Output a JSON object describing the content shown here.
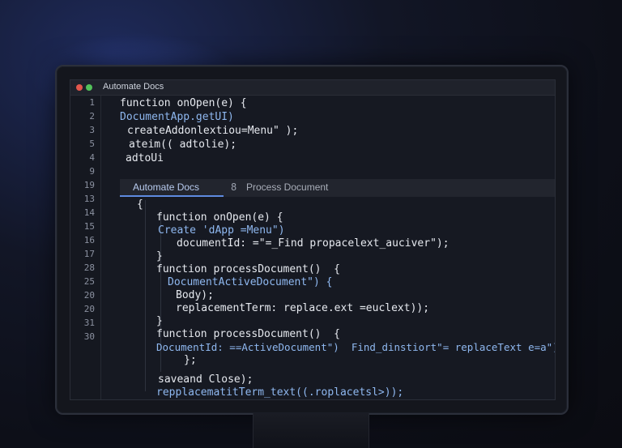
{
  "window": {
    "title": "Automate Docs"
  },
  "tabs": [
    {
      "label": "Automate Docs",
      "active": true
    },
    {
      "label": "Process Document",
      "active": false,
      "icon_glyph": "8"
    }
  ],
  "line_numbers": [
    "1",
    "2",
    "3",
    "5",
    "4",
    "9",
    "19",
    "13",
    "14",
    "15",
    "16",
    "17",
    "28",
    "25",
    "20",
    "20",
    "31",
    "30"
  ],
  "code_top": [
    "function onOpen(e) {",
    "DocumentApp.getUI)",
    "createAddonlextiou=Menu\" );",
    "ateim(( adtolie);",
    "adtoUi"
  ],
  "code_body": [
    "{",
    "function onOpen(e) {",
    "Create 'dApp =Menu\")",
    "documentId: =\"=_Find propacelext_auciver\");",
    "}",
    "function processDocument()  {",
    "DocumentActiveDocument\") {",
    "Body);",
    "replacementTerm: replace.ext =euclext));",
    "}",
    "function processDocument()  {",
    "DocumentId: ==ActiveDocument\")  Find_dinstiort\"= replaceText e=a\");",
    "};",
    "saveand Close);",
    "repplacematitTerm_text((.roplacetsl>));",
    "}"
  ],
  "colors": {
    "accent": "#5e8ae0",
    "code_blue": "#8fb8f0",
    "background": "#161922"
  }
}
